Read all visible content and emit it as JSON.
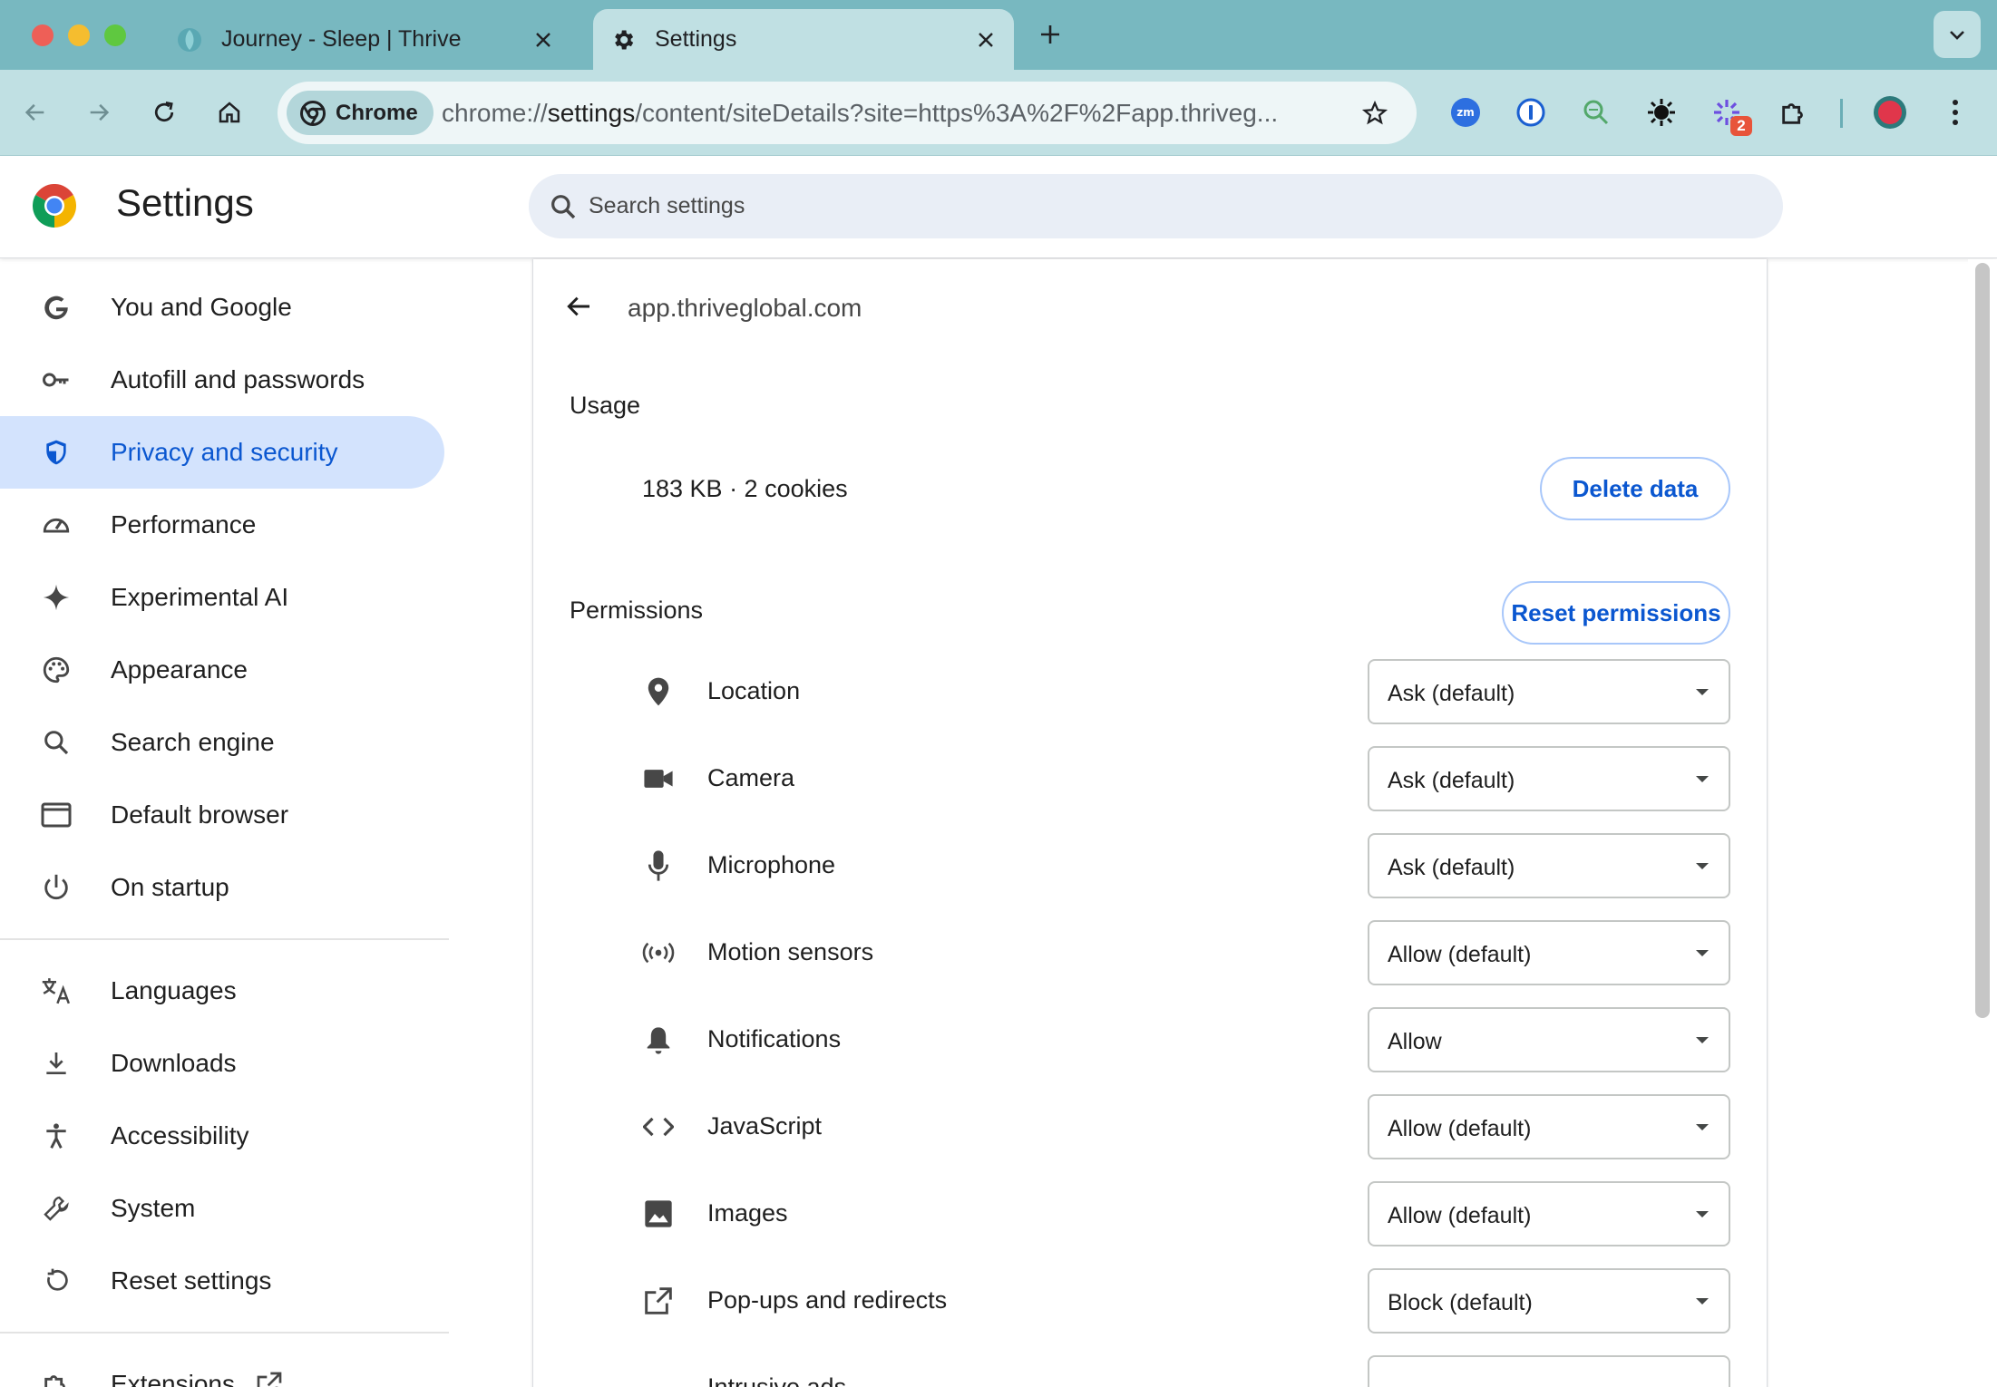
{
  "browser": {
    "tabs": [
      {
        "title": "Journey - Sleep | Thrive",
        "active": false
      },
      {
        "title": "Settings",
        "active": true
      }
    ],
    "address_chip": "Chrome",
    "url_prefix": "chrome://",
    "url_host": "settings",
    "url_rest": "/content/siteDetails?site=https%3A%2F%2Fapp.thriveg...",
    "extension_badge": "2"
  },
  "header": {
    "title": "Settings",
    "search_placeholder": "Search settings"
  },
  "sidebar": {
    "items": [
      {
        "label": "You and Google",
        "icon": "google-g-icon"
      },
      {
        "label": "Autofill and passwords",
        "icon": "key-icon"
      },
      {
        "label": "Privacy and security",
        "icon": "shield-icon",
        "active": true
      },
      {
        "label": "Performance",
        "icon": "speedometer-icon"
      },
      {
        "label": "Experimental AI",
        "icon": "sparkle-icon"
      },
      {
        "label": "Appearance",
        "icon": "palette-icon"
      },
      {
        "label": "Search engine",
        "icon": "search-icon"
      },
      {
        "label": "Default browser",
        "icon": "browser-window-icon"
      },
      {
        "label": "On startup",
        "icon": "power-icon"
      }
    ],
    "items2": [
      {
        "label": "Languages",
        "icon": "translate-icon"
      },
      {
        "label": "Downloads",
        "icon": "download-icon"
      },
      {
        "label": "Accessibility",
        "icon": "accessibility-icon"
      },
      {
        "label": "System",
        "icon": "wrench-icon"
      },
      {
        "label": "Reset settings",
        "icon": "reset-icon"
      }
    ],
    "items3": [
      {
        "label": "Extensions",
        "icon": "external-link-icon"
      }
    ]
  },
  "site": {
    "name": "app.thriveglobal.com",
    "usage_label": "Usage",
    "usage_value": "183 KB · 2 cookies",
    "delete_button": "Delete data",
    "permissions_label": "Permissions",
    "reset_button": "Reset permissions",
    "permissions": [
      {
        "label": "Location",
        "value": "Ask (default)",
        "icon": "location-pin-icon"
      },
      {
        "label": "Camera",
        "value": "Ask (default)",
        "icon": "camera-icon"
      },
      {
        "label": "Microphone",
        "value": "Ask (default)",
        "icon": "microphone-icon"
      },
      {
        "label": "Motion sensors",
        "value": "Allow (default)",
        "icon": "motion-sensors-icon"
      },
      {
        "label": "Notifications",
        "value": "Allow",
        "icon": "bell-icon"
      },
      {
        "label": "JavaScript",
        "value": "Allow (default)",
        "icon": "code-icon"
      },
      {
        "label": "Images",
        "value": "Allow (default)",
        "icon": "image-icon"
      },
      {
        "label": "Pop-ups and redirects",
        "value": "Block (default)",
        "icon": "open-in-new-icon"
      },
      {
        "label": "Intrusive ads",
        "value": "",
        "icon": ""
      }
    ]
  }
}
